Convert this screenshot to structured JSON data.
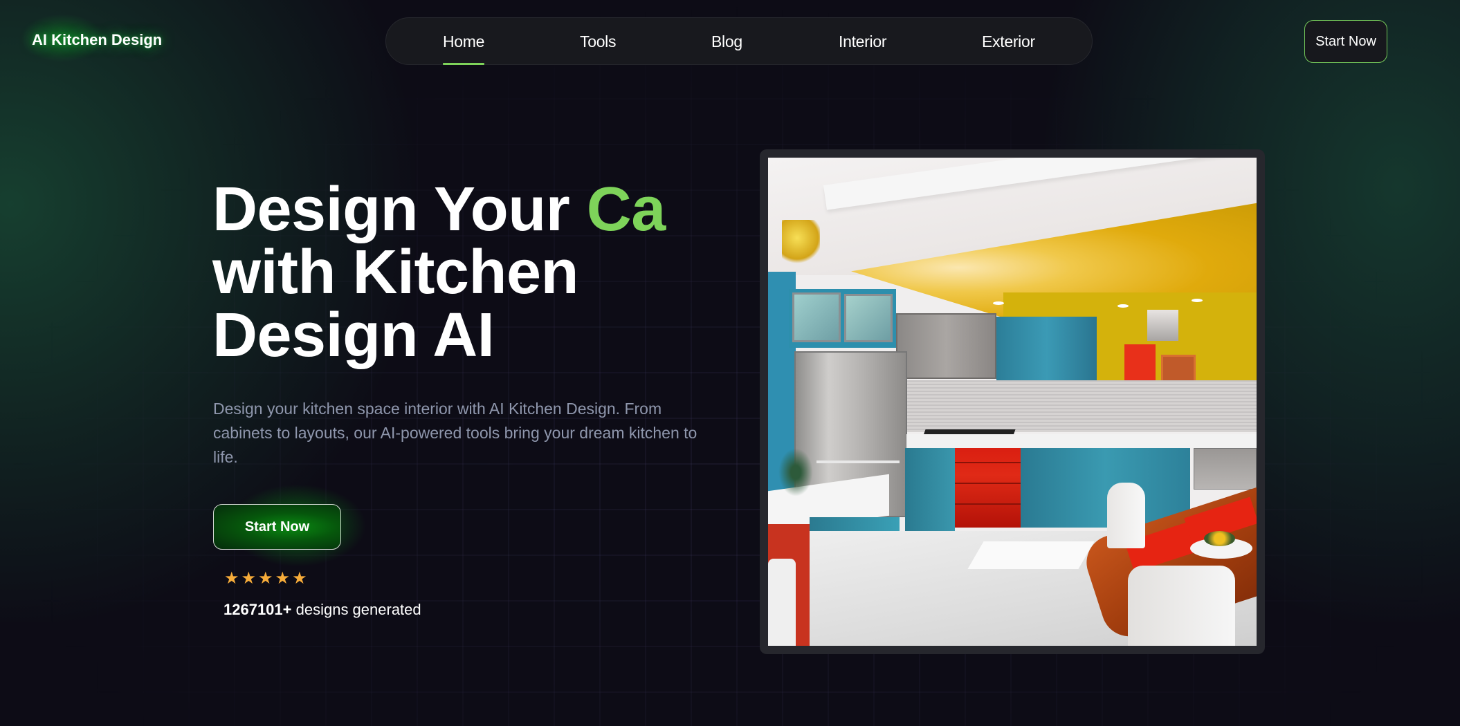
{
  "header": {
    "logo_text": "AI Kitchen Design",
    "nav": [
      {
        "label": "Home",
        "active": true
      },
      {
        "label": "Tools",
        "active": false
      },
      {
        "label": "Blog",
        "active": false
      },
      {
        "label": "Interior",
        "active": false
      },
      {
        "label": "Exterior",
        "active": false
      }
    ],
    "cta_label": "Start Now"
  },
  "hero": {
    "title_line1_prefix": "Design Your ",
    "title_line1_accent": "Ca",
    "title_line2": "with Kitchen",
    "title_line3": "Design AI",
    "description": "Design your kitchen space interior with AI Kitchen Design. From cabinets to layouts, our AI-powered tools bring your dream kitchen to life.",
    "cta_label": "Start Now",
    "rating_stars": 5,
    "rating_max": 5,
    "star_glyph": "★",
    "designs_count": "1267101+",
    "designs_label": " designs generated"
  },
  "showcase": {
    "image_alt": "Colorful AI-generated kitchen with teal cabinets, red drawers, yellow ceiling and dining table"
  },
  "colors": {
    "accent_green": "#7ed35a",
    "background": "#0d0c16",
    "nav_bg": "#18191e",
    "description_text": "#8f97ad",
    "star": "#f6ac3a"
  }
}
